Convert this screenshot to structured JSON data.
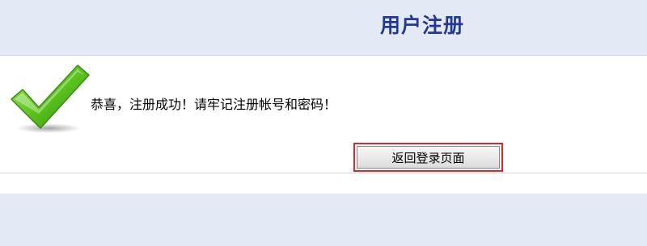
{
  "header": {
    "title": "用户注册"
  },
  "main": {
    "icon": "checkmark-icon",
    "message": "恭喜，注册成功！请牢记注册帐号和密码！",
    "back_button_label": "返回登录页面"
  },
  "colors": {
    "title": "#23399a",
    "background": "#e4e9f6",
    "highlight": "#e0262d",
    "check_green": "#5cc41e"
  }
}
